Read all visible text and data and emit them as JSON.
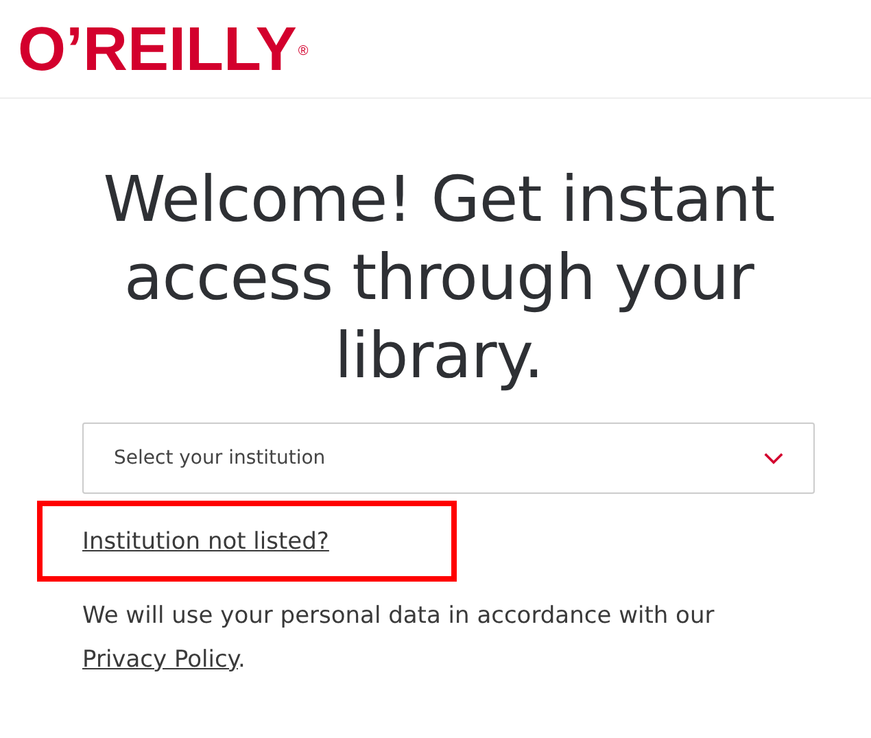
{
  "header": {
    "logo": "O’REILLY",
    "logo_mark": "®"
  },
  "heading": "Welcome! Get instant access through your library.",
  "institution_select": {
    "placeholder": "Select your institution"
  },
  "institution_link": {
    "label": "Institution not listed?",
    "highlighted": true
  },
  "privacy_notice": {
    "text": "We will use your personal data in accordance with our ",
    "link": "Privacy Policy",
    "after": "."
  }
}
